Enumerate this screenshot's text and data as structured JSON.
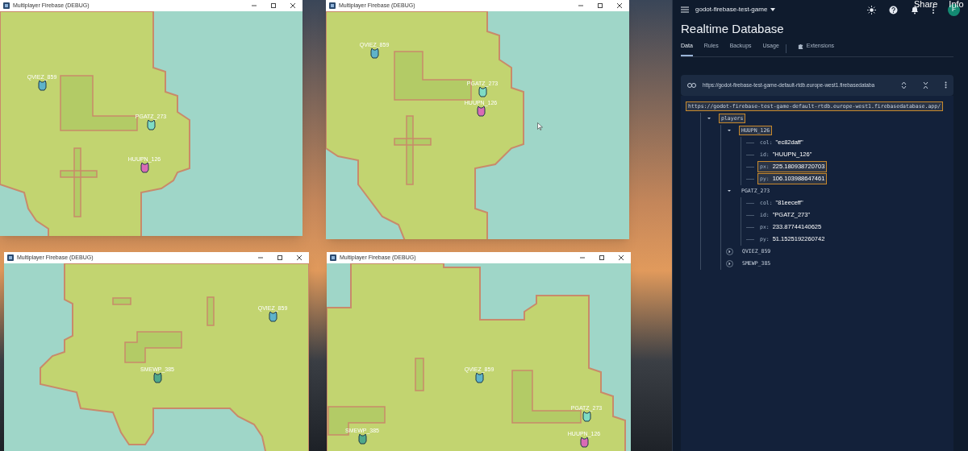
{
  "game_windows": [
    {
      "title": "Multiplayer Firebase (DEBUG)",
      "players": [
        {
          "name": "QVIEZ_859",
          "color": "#5fb3c9"
        },
        {
          "name": "PGATZ_273",
          "color": "#7fdcc4"
        },
        {
          "name": "HUUPN_126",
          "color": "#d96bb5"
        }
      ]
    },
    {
      "title": "Multiplayer Firebase (DEBUG)",
      "players": [
        {
          "name": "QVIEZ_859",
          "color": "#5fb3c9"
        },
        {
          "name": "PGATZ_273",
          "color": "#7fdcc4"
        },
        {
          "name": "HUUPN_126",
          "color": "#d96bb5"
        }
      ]
    },
    {
      "title": "Multiplayer Firebase (DEBUG)",
      "players": [
        {
          "name": "QVIEZ_859",
          "color": "#5fb3c9"
        },
        {
          "name": "SMEWP_385",
          "color": "#4fa88a"
        }
      ]
    },
    {
      "title": "Multiplayer Firebase (DEBUG)",
      "players": [
        {
          "name": "QVIEZ_859",
          "color": "#5fb3c9"
        },
        {
          "name": "PGATZ_273",
          "color": "#7fdcc4"
        },
        {
          "name": "SMEWP_385",
          "color": "#4fa88a"
        },
        {
          "name": "HUUPN_126",
          "color": "#d96bb5"
        }
      ]
    }
  ],
  "video_overlay": [
    "Share",
    "Info"
  ],
  "console": {
    "project": "godot-firebase-test-game",
    "avatar": "F",
    "title": "Realtime Database",
    "tabs": [
      {
        "label": "Data",
        "selected": true
      },
      {
        "label": "Rules",
        "selected": false
      },
      {
        "label": "Backups",
        "selected": false
      },
      {
        "label": "Usage",
        "selected": false
      },
      {
        "label": "Extensions",
        "selected": false
      }
    ],
    "url_bar": "https://godot-firebase-test-game-default-rtdb.europe-west1.firebasedataba",
    "root": {
      "key": "https://godot-firebase-test-game-default-rtdb.europe-west1.firebasedatabase.app/",
      "highlighted": true,
      "children": [
        {
          "key": "players",
          "highlighted": true,
          "expanded": true,
          "children": [
            {
              "key": "HUUPN_126",
              "highlighted": true,
              "expanded": true,
              "children": [
                {
                  "key": "col:",
                  "value": "\"ec82daff\"",
                  "highlighted": false
                },
                {
                  "key": "id:",
                  "value": "\"HUUPN_126\"",
                  "highlighted": false
                },
                {
                  "key": "px:",
                  "value": "225.180938720703",
                  "highlighted": true
                },
                {
                  "key": "py:",
                  "value": "106.103988647461",
                  "highlighted": true
                }
              ]
            },
            {
              "key": "PGATZ_273",
              "highlighted": false,
              "expanded": true,
              "children": [
                {
                  "key": "col:",
                  "value": "\"81eeceff\"",
                  "highlighted": false
                },
                {
                  "key": "id:",
                  "value": "\"PGATZ_273\"",
                  "highlighted": false
                },
                {
                  "key": "px:",
                  "value": "233.87744140625",
                  "highlighted": false
                },
                {
                  "key": "py:",
                  "value": "51.1525192260742",
                  "highlighted": false
                }
              ]
            },
            {
              "key": "QVIEZ_859",
              "highlighted": false,
              "expanded": false
            },
            {
              "key": "SMEWP_385",
              "highlighted": false,
              "expanded": false
            }
          ]
        }
      ]
    }
  }
}
